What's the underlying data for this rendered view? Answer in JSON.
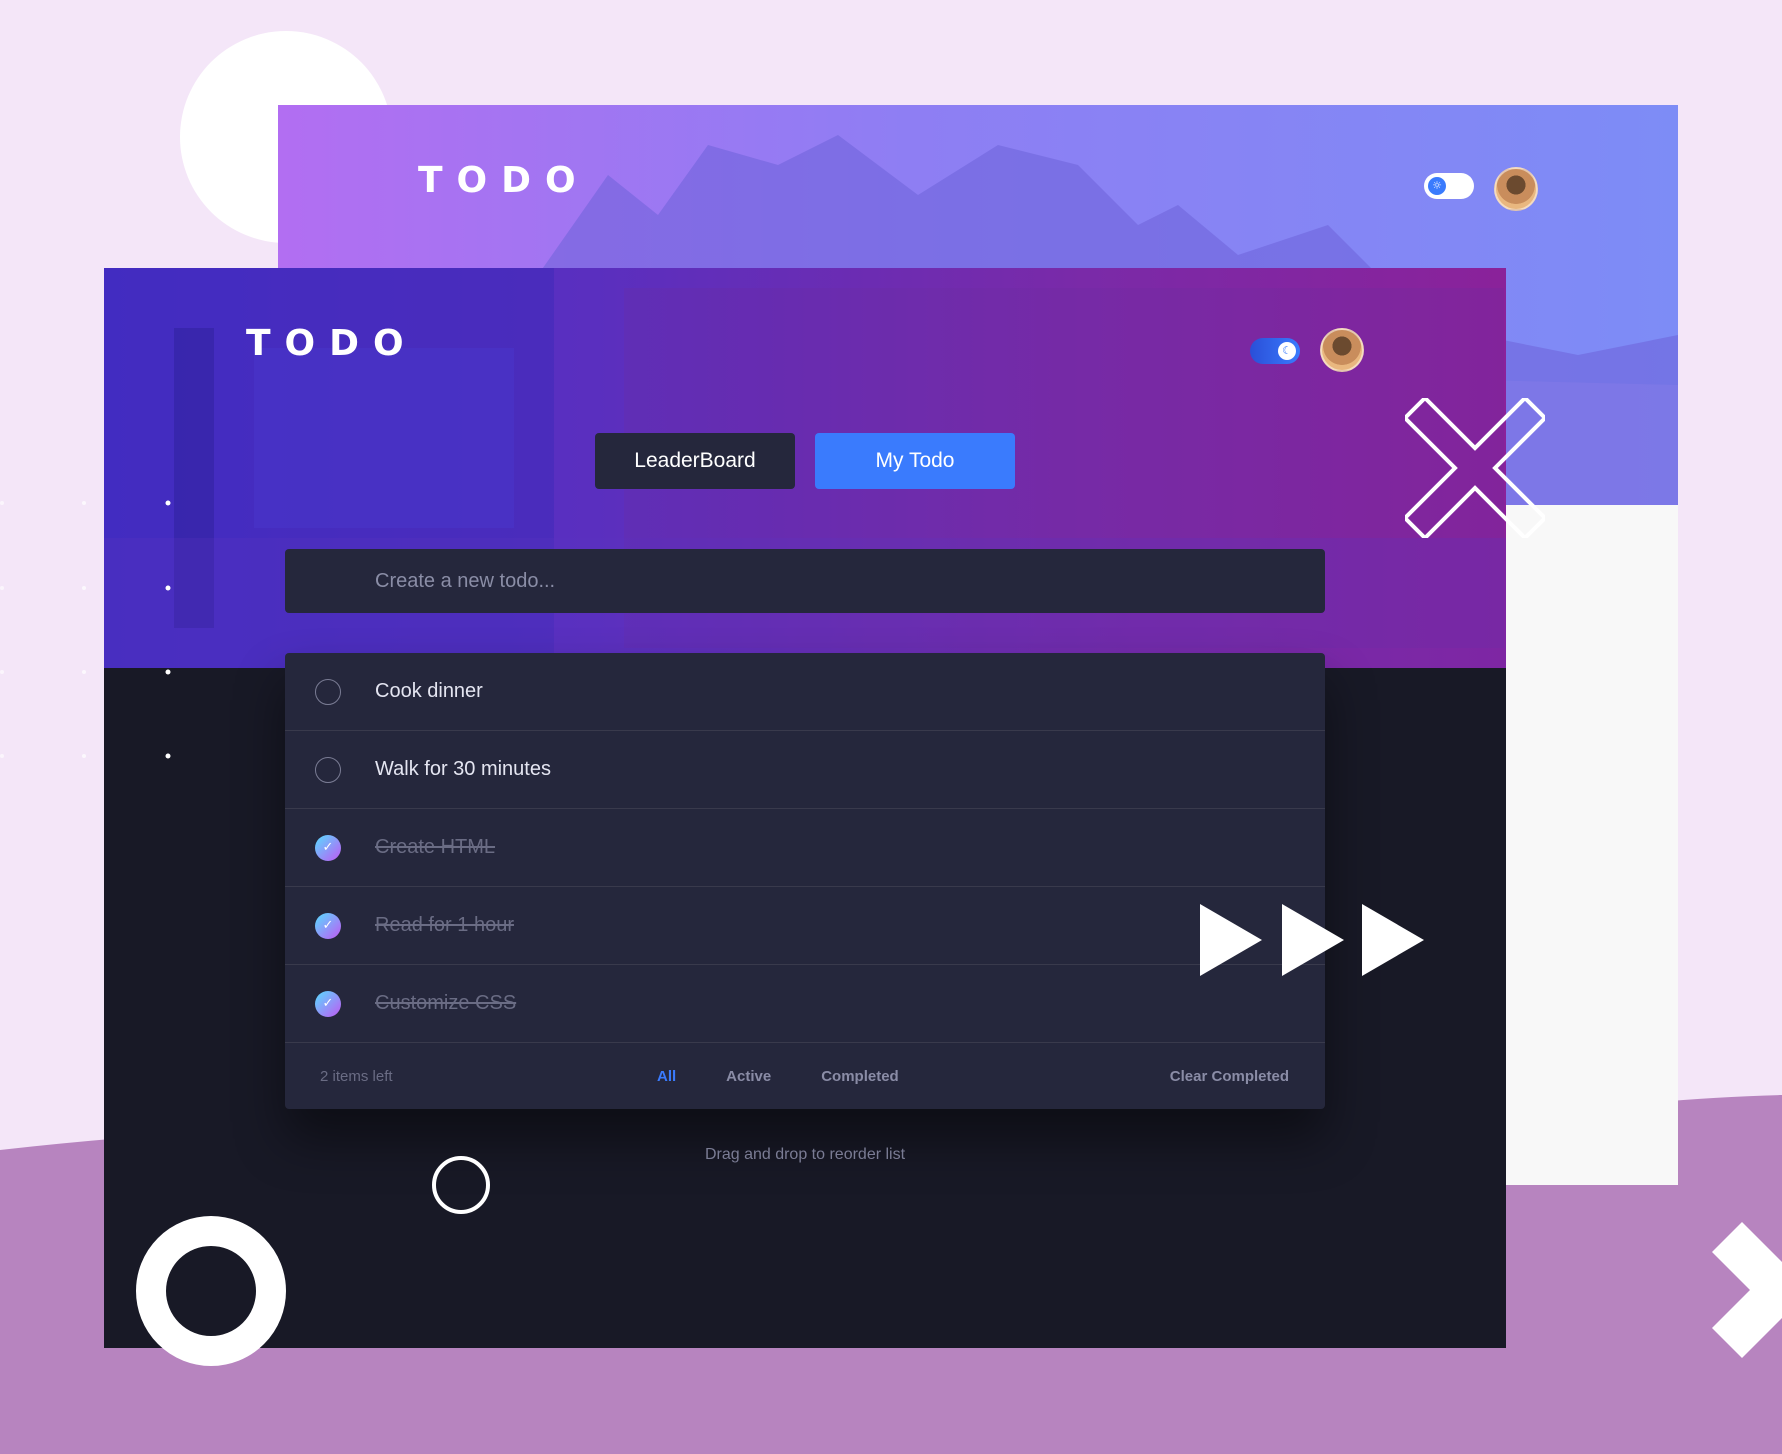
{
  "back_app": {
    "logo": "TODO",
    "toggle_icon": "sun-icon",
    "avatar": "user-avatar"
  },
  "front_app": {
    "logo": "TODO",
    "toggle_icon": "moon-icon",
    "avatar": "user-avatar",
    "tabs": [
      {
        "label": "LeaderBoard",
        "active": false
      },
      {
        "label": "My Todo",
        "active": true
      }
    ],
    "new_todo": {
      "placeholder": "Create a new todo...",
      "value": ""
    },
    "todos": [
      {
        "text": "Cook dinner",
        "completed": false
      },
      {
        "text": "Walk for 30 minutes",
        "completed": false
      },
      {
        "text": "Create HTML",
        "completed": true
      },
      {
        "text": "Read for 1 hour",
        "completed": true
      },
      {
        "text": "Customize CSS",
        "completed": true
      }
    ],
    "footer": {
      "items_left": "2 items left",
      "filters": [
        "All",
        "Active",
        "Completed"
      ],
      "active_filter": "All",
      "clear_label": "Clear Completed"
    },
    "drag_hint": "Drag and drop to reorder list"
  },
  "colors": {
    "page_bg": "#f4e6f8",
    "wave": "#b784bf",
    "accent": "#3a7bfd",
    "dark_bg": "#181926",
    "card": "#25273c"
  }
}
